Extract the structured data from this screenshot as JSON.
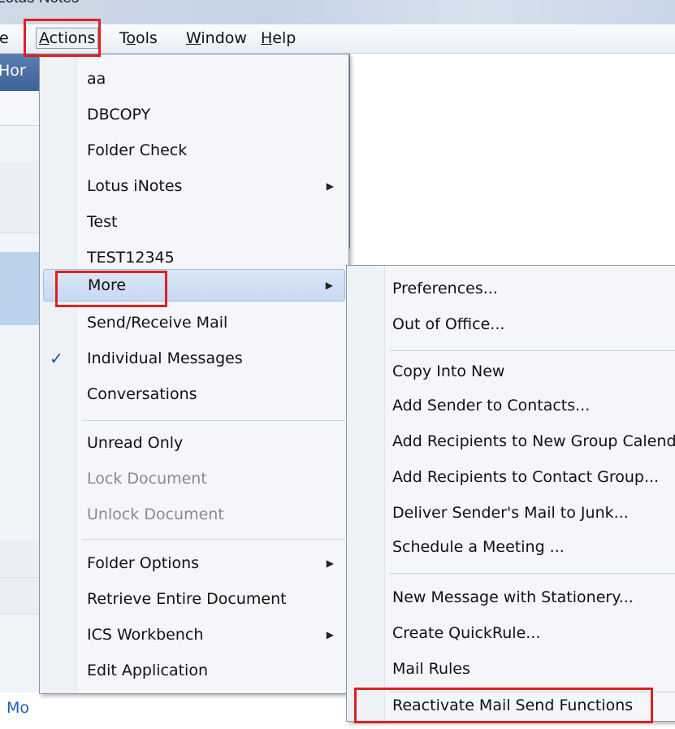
{
  "window": {
    "title": "Lotus Notes"
  },
  "menubar": {
    "items": [
      {
        "key": "file",
        "label": "e"
      },
      {
        "key": "actions",
        "label": "Actions",
        "ul": "A",
        "rest": "ctions"
      },
      {
        "key": "tools",
        "label": "Tools",
        "pre": "T",
        "ul": "o",
        "rest": "ols"
      },
      {
        "key": "window",
        "label": "Window",
        "ul": "W",
        "rest": "indow"
      },
      {
        "key": "help",
        "label": "Help",
        "ul": "H",
        "rest": "elp"
      }
    ]
  },
  "background": {
    "header_fragment": "Hor",
    "bottom_fragment": "Mo"
  },
  "actions_menu": {
    "items": [
      {
        "label": "aa"
      },
      {
        "label": "DBCOPY"
      },
      {
        "label": "Folder Check"
      },
      {
        "label": "Lotus iNotes",
        "submenu": true
      },
      {
        "label": "Test"
      },
      {
        "label": "TEST12345"
      },
      {
        "label": "More",
        "submenu": true,
        "highlighted": true
      },
      {
        "label": "Send/Receive Mail"
      },
      {
        "label": "Individual Messages",
        "checked": true,
        "check_glyph": "✓"
      },
      {
        "label": "Conversations"
      },
      {
        "label": "Unread Only"
      },
      {
        "label": "Lock Document",
        "disabled": true
      },
      {
        "label": "Unlock Document",
        "disabled": true
      },
      {
        "label": "Folder Options",
        "submenu": true
      },
      {
        "label": "Retrieve Entire Document"
      },
      {
        "label": "ICS Workbench",
        "submenu": true
      },
      {
        "label": "Edit Application"
      }
    ]
  },
  "more_submenu": {
    "items": [
      {
        "label": "Preferences..."
      },
      {
        "label": "Out of Office..."
      },
      {
        "label": "Copy Into New"
      },
      {
        "label": "Add Sender to Contacts..."
      },
      {
        "label": "Add Recipients to New Group Calenda"
      },
      {
        "label": "Add Recipients to Contact Group..."
      },
      {
        "label": "Deliver Sender's Mail to Junk..."
      },
      {
        "label": "Schedule a Meeting ..."
      },
      {
        "label": "New Message with Stationery..."
      },
      {
        "label": "Create QuickRule..."
      },
      {
        "label": "Mail Rules"
      },
      {
        "label": "Reactivate Mail Send Functions"
      }
    ]
  },
  "colors": {
    "highlight_box": "#e02020",
    "check": "#1b4fa0"
  }
}
